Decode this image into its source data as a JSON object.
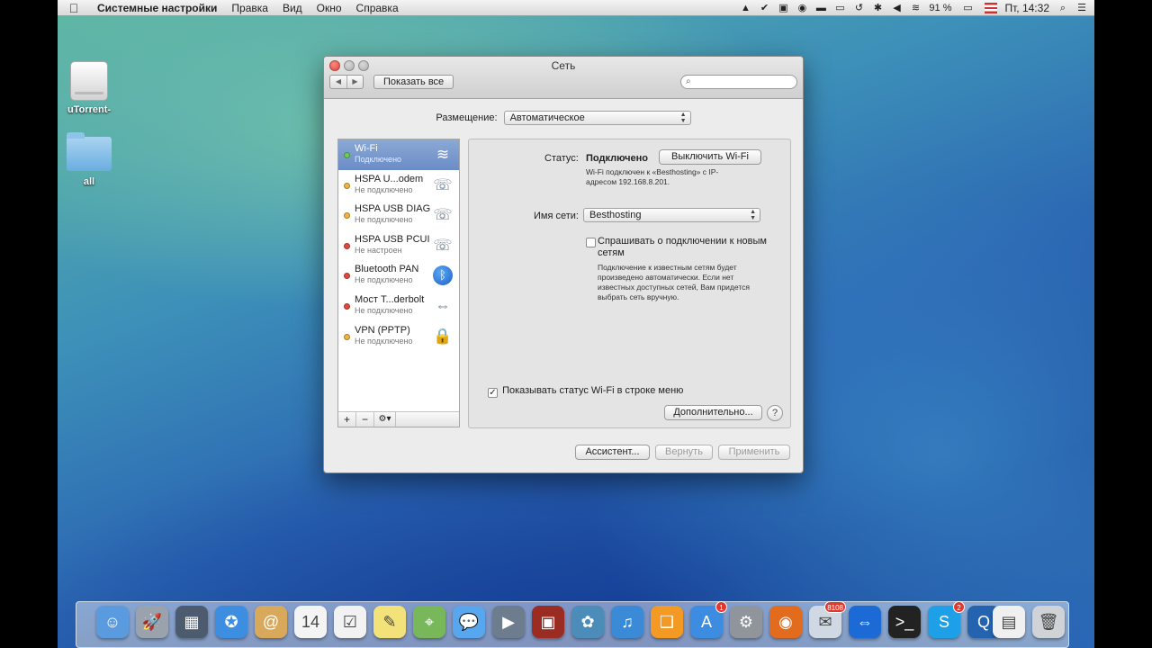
{
  "menubar": {
    "app_name": "Системные настройки",
    "items": [
      "Правка",
      "Вид",
      "Окно",
      "Справка"
    ],
    "battery": "91 %",
    "clock": "Пт, 14:32"
  },
  "desktop": {
    "icons": [
      {
        "label": "uTorrent-",
        "icon": "drive-icon"
      },
      {
        "label": "all",
        "icon": "folder-icon"
      }
    ]
  },
  "window": {
    "title": "Сеть",
    "show_all": "Показать все",
    "location_label": "Размещение:",
    "location_value": "Автоматическое",
    "services": [
      {
        "name": "Wi-Fi",
        "status": "Подключено",
        "dot": "green",
        "icon": "wifi-icon",
        "selected": true
      },
      {
        "name": "HSPA U...odem",
        "status": "Не подключено",
        "dot": "yellow",
        "icon": "phone-icon"
      },
      {
        "name": "HSPA USB DIAG",
        "status": "Не подключено",
        "dot": "yellow",
        "icon": "phone-icon"
      },
      {
        "name": "HSPA USB PCUI",
        "status": "Не настроен",
        "dot": "red",
        "icon": "phone-icon"
      },
      {
        "name": "Bluetooth PAN",
        "status": "Не подключено",
        "dot": "red",
        "icon": "bluetooth-icon"
      },
      {
        "name": "Мост T...derbolt",
        "status": "Не подключено",
        "dot": "red",
        "icon": "bridge-icon"
      },
      {
        "name": "VPN (PPTP)",
        "status": "Не подключено",
        "dot": "yellow",
        "icon": "lock-icon"
      }
    ],
    "sidebar_footer": [
      "+",
      "−",
      "⚙▾"
    ],
    "detail": {
      "status_label": "Статус:",
      "status_value": "Подключено",
      "turn_off_button": "Выключить Wi-Fi",
      "status_desc_1": "Wi-Fi подключен к «Besthosting» с IP-",
      "status_desc_2": "адресом 192.168.8.201.",
      "network_name_label": "Имя сети:",
      "network_name_value": "Besthosting",
      "ask_join_label_1": "Спрашивать о подключении к новым",
      "ask_join_label_2": "сетям",
      "ask_join_desc_1": "Подключение к известным сетям будет",
      "ask_join_desc_2": "произведено автоматически. Если нет",
      "ask_join_desc_3": "известных доступных сетей, Вам придется",
      "ask_join_desc_4": "выбрать сеть вручную.",
      "show_status_label": "Показывать статус Wi-Fi в строке меню",
      "advanced_button": "Дополнительно...",
      "help": "?"
    },
    "footer": {
      "assistant": "Ассистент...",
      "revert": "Вернуть",
      "apply": "Применить"
    }
  },
  "dock": {
    "items": [
      {
        "name": "finder-icon",
        "color": "#5a9be0",
        "glyph": "☺"
      },
      {
        "name": "launchpad-icon",
        "color": "#9aa3ad",
        "glyph": "🚀"
      },
      {
        "name": "mission-control-icon",
        "color": "#4d5b6e",
        "glyph": "▦"
      },
      {
        "name": "safari-icon",
        "color": "#3d8ee0",
        "glyph": "✪"
      },
      {
        "name": "contacts-icon",
        "color": "#d9a95b",
        "glyph": "@"
      },
      {
        "name": "calendar-icon",
        "color": "#f4f4f4",
        "glyph": "14"
      },
      {
        "name": "reminders-icon",
        "color": "#f2f2f2",
        "glyph": "☑"
      },
      {
        "name": "notes-icon",
        "color": "#f3e27a",
        "glyph": "✎"
      },
      {
        "name": "maps-icon",
        "color": "#79b85a",
        "glyph": "⌖"
      },
      {
        "name": "messages-icon",
        "color": "#58a6ee",
        "glyph": "💬"
      },
      {
        "name": "facetime-icon",
        "color": "#6d7d8e",
        "glyph": "▶"
      },
      {
        "name": "photo-booth-icon",
        "color": "#9a2c22",
        "glyph": "▣"
      },
      {
        "name": "iphoto-icon",
        "color": "#4c8cb8",
        "glyph": "✿"
      },
      {
        "name": "itunes-icon",
        "color": "#3a8ad8",
        "glyph": "♫"
      },
      {
        "name": "ibooks-icon",
        "color": "#f29a24",
        "glyph": "❑"
      },
      {
        "name": "app-store-icon",
        "color": "#3c8de2",
        "glyph": "A",
        "badge": "1"
      },
      {
        "name": "system-preferences-icon",
        "color": "#8f959b",
        "glyph": "⚙"
      },
      {
        "name": "firefox-icon",
        "color": "#e36b1e",
        "glyph": "◉"
      },
      {
        "name": "mail-icon",
        "color": "#cfd8e3",
        "glyph": "✉",
        "badge": "8108"
      },
      {
        "name": "teamviewer-icon",
        "color": "#1b6ad6",
        "glyph": "⇔"
      },
      {
        "name": "terminal-icon",
        "color": "#222222",
        "glyph": ">_"
      },
      {
        "name": "skype-icon",
        "color": "#1ea0e8",
        "glyph": "S",
        "badge": "2"
      },
      {
        "name": "quicktime-icon",
        "color": "#2463b0",
        "glyph": "Q"
      },
      {
        "name": "document-icon",
        "color": "#f0f0f0",
        "glyph": "▤"
      },
      {
        "name": "trash-icon",
        "color": "#cfd3d8",
        "glyph": "🗑"
      }
    ]
  }
}
